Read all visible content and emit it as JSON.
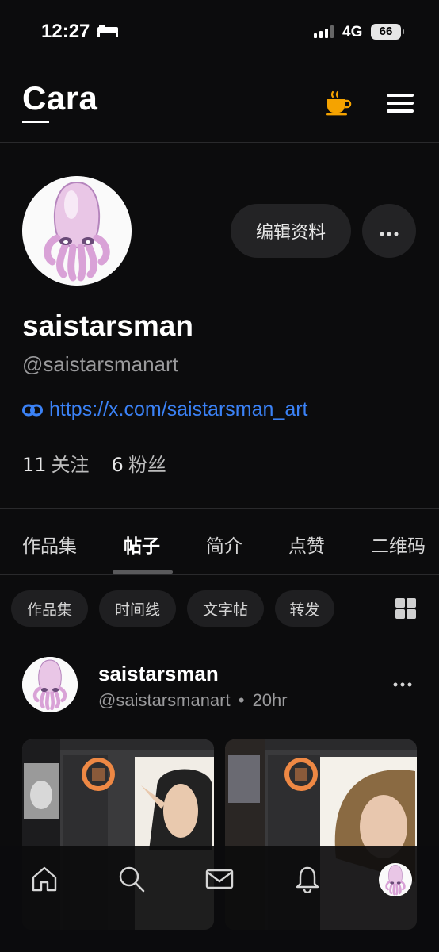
{
  "status_bar": {
    "time": "12:27",
    "network": "4G",
    "battery": "66"
  },
  "header": {
    "logo": "Cara",
    "coffee_icon": "coffee-cup-icon",
    "menu_icon": "hamburger-menu-icon",
    "accent": "#f5a300"
  },
  "profile": {
    "edit_button": "编辑资料",
    "display_name": "saistarsman",
    "handle": "@saistarsmanart",
    "link": "https://x.com/saistarsman_art",
    "following_count": "11",
    "following_label": "关注",
    "followers_count": "6",
    "followers_label": "粉丝"
  },
  "tabs": [
    {
      "label": "作品集"
    },
    {
      "label": "帖子",
      "active": true
    },
    {
      "label": "简介"
    },
    {
      "label": "点赞"
    },
    {
      "label": "二维码"
    }
  ],
  "filters": [
    "作品集",
    "时间线",
    "文字帖",
    "转发"
  ],
  "post": {
    "author_name": "saistarsman",
    "author_handle": "@saistarsmanart",
    "separator": "•",
    "time_ago": "20hr"
  },
  "bottom_nav": [
    "home-icon",
    "search-icon",
    "mail-icon",
    "bell-icon",
    "profile-avatar"
  ],
  "colors": {
    "background": "#0c0c0d",
    "link": "#3b82f6",
    "chip": "#1f1f21"
  }
}
